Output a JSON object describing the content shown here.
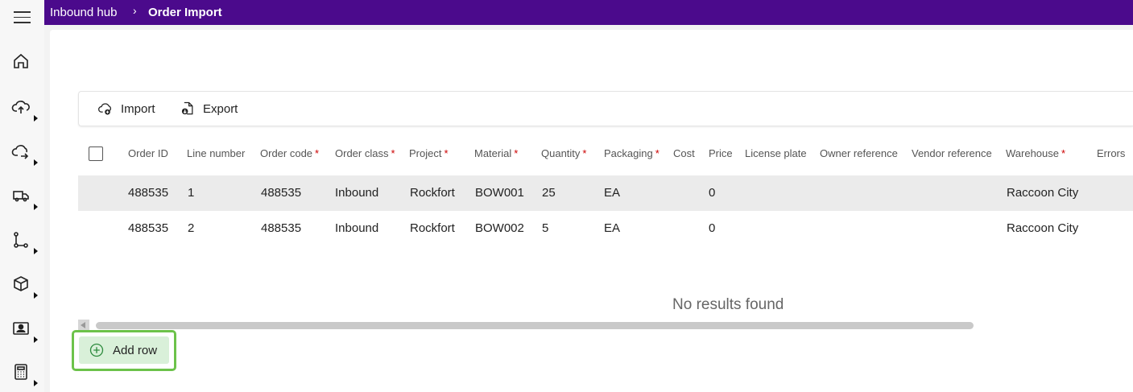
{
  "breadcrumb": {
    "root": "Inbound hub",
    "separator": "›",
    "current": "Order Import"
  },
  "toolbar": {
    "import_label": "Import",
    "export_label": "Export"
  },
  "table": {
    "columns": [
      {
        "label": "Order ID",
        "required": false
      },
      {
        "label": "Line number",
        "required": false
      },
      {
        "label": "Order code",
        "required": true
      },
      {
        "label": "Order class",
        "required": true
      },
      {
        "label": "Project",
        "required": true
      },
      {
        "label": "Material",
        "required": true
      },
      {
        "label": "Quantity",
        "required": true
      },
      {
        "label": "Packaging",
        "required": true
      },
      {
        "label": "Cost",
        "required": false
      },
      {
        "label": "Price",
        "required": false
      },
      {
        "label": "License plate",
        "required": false
      },
      {
        "label": "Owner reference",
        "required": false
      },
      {
        "label": "Vendor reference",
        "required": false
      },
      {
        "label": "Warehouse",
        "required": true
      },
      {
        "label": "Errors",
        "required": false
      }
    ],
    "required_mark": "*",
    "rows": [
      [
        "488535",
        "1",
        "488535",
        "Inbound",
        "Rockfort",
        "BOW001",
        "25",
        "EA",
        "",
        "0",
        "",
        "",
        "",
        "Raccoon City",
        ""
      ],
      [
        "488535",
        "2",
        "488535",
        "Inbound",
        "Rockfort",
        "BOW002",
        "5",
        "EA",
        "",
        "0",
        "",
        "",
        "",
        "Raccoon City",
        ""
      ]
    ],
    "empty_message": "No results found"
  },
  "add_row_label": "Add row",
  "colors": {
    "topbar": "#4b0a8c",
    "required": "#cc0000",
    "add_row_bg": "#d9f0d9",
    "add_row_border": "#6cc24a"
  },
  "rail_icons": [
    "menu-icon",
    "home-icon",
    "cloud-upload-icon",
    "cloud-transfer-icon",
    "truck-icon",
    "workflow-icon",
    "package-icon",
    "contact-card-icon",
    "calculator-icon"
  ]
}
